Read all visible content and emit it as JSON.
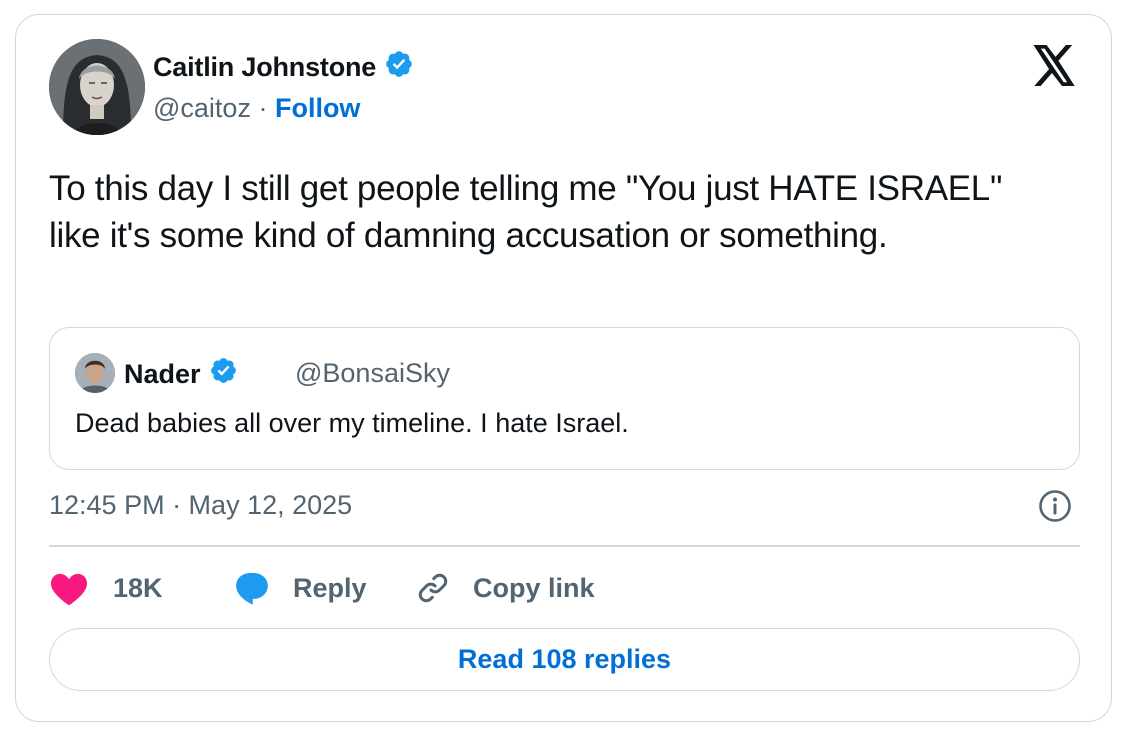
{
  "author": {
    "name": "Caitlin Johnstone",
    "handle": "@caitoz",
    "separator": " · ",
    "follow_label": "Follow"
  },
  "tweet": {
    "text": "To this day I still get people telling me \"You just HATE ISRAEL\" like it's some kind of damning accusation or something."
  },
  "quote": {
    "name": "Nader",
    "handle": "@BonsaiSky",
    "text": "Dead babies all over my timeline. I hate Israel."
  },
  "timestamp": "12:45 PM · May 12, 2025",
  "actions": {
    "likes": "18K",
    "reply_label": "Reply",
    "copy_label": "Copy link"
  },
  "read_replies_label": "Read 108 replies",
  "colors": {
    "accent": "#006fd6",
    "verified": "#1d9bf0",
    "heart": "#f91880",
    "muted": "#536471",
    "border": "#cfd9de"
  },
  "icons": [
    "x-logo-icon",
    "verified-badge-icon",
    "info-icon",
    "heart-icon",
    "reply-bubble-icon",
    "link-icon"
  ]
}
